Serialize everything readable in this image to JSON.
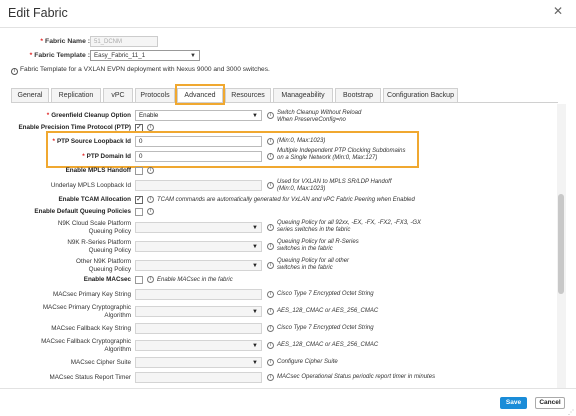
{
  "dialog": {
    "title": "Edit Fabric",
    "close_icon": "✕"
  },
  "fabric_name": {
    "label": "Fabric Name :",
    "value": "51_DCNM"
  },
  "fabric_template": {
    "label": "Fabric Template :",
    "value": "Easy_Fabric_11_1"
  },
  "info_text": "Fabric Template for a VXLAN EVPN deployment with Nexus 9000 and 3000 switches.",
  "tabs": [
    {
      "label": "General"
    },
    {
      "label": "Replication"
    },
    {
      "label": "vPC"
    },
    {
      "label": "Protocols"
    },
    {
      "label": "Advanced"
    },
    {
      "label": "Resources"
    },
    {
      "label": "Manageability"
    },
    {
      "label": "Bootstrap"
    },
    {
      "label": "Configuration Backup"
    }
  ],
  "active_tab": "Advanced",
  "fields": {
    "greenfield": {
      "label": "Greenfield Cleanup Option",
      "value": "Enable",
      "help": [
        "Switch Cleanup Without Reload",
        "When PreserveConfig=no"
      ]
    },
    "ptp": {
      "label": "Enable Precision Time Protocol (PTP)",
      "checked": "✓"
    },
    "ptp_loopback": {
      "label": "PTP Source Loopback Id",
      "value": "0",
      "help": [
        "(Min:0, Max:1023)"
      ]
    },
    "ptp_domain": {
      "label": "PTP Domain Id",
      "value": "0",
      "help": [
        "Multiple Independent PTP Clocking Subdomains",
        "on a Single Network (Min:0, Max:127)"
      ]
    },
    "mpls_handoff": {
      "label": "Enable MPLS Handoff"
    },
    "underlay_mpls": {
      "label": "Underlay MPLS Loopback Id",
      "help": [
        "Used for VXLAN to MPLS SR/LDP Handoff",
        "(Min:0, Max:1023)"
      ]
    },
    "tcam": {
      "label": "Enable TCAM Allocation",
      "checked": "✓",
      "help": [
        "TCAM commands are automatically generated for VxLAN and vPC Fabric Peering when Enabled"
      ]
    },
    "default_queuing": {
      "label": "Enable Default Queuing Policies"
    },
    "n9k_cloud": {
      "label": [
        "N9K Cloud Scale Platform",
        "Queuing Policy"
      ],
      "help": [
        "Queuing Policy for all 92xx, -EX, -FX, -FX2, -FX3, -GX",
        "series switches in the fabric"
      ]
    },
    "n9k_rseries": {
      "label": [
        "N9K R-Series Platform",
        "Queuing Policy"
      ],
      "help": [
        "Queuing Policy for all R-Series",
        "switches in the fabric"
      ]
    },
    "other_n9k": {
      "label": [
        "Other N9K Platform",
        "Queuing Policy"
      ],
      "help": [
        "Queuing Policy for all other",
        "switches in the fabric"
      ]
    },
    "macsec": {
      "label": "Enable MACsec",
      "help": [
        "Enable MACsec in the fabric"
      ]
    },
    "macsec_primary_key": {
      "label": "MACsec Primary Key String",
      "help": [
        "Cisco Type 7 Encrypted Octet String"
      ]
    },
    "macsec_primary_algo": {
      "label": [
        "MACsec Primary Cryptographic",
        "Algorithm"
      ],
      "help": [
        "AES_128_CMAC or AES_256_CMAC"
      ]
    },
    "macsec_fallback_key": {
      "label": "MACsec Fallback Key String",
      "help": [
        "Cisco Type 7 Encrypted Octet String"
      ]
    },
    "macsec_fallback_algo": {
      "label": [
        "MACsec Fallback Cryptographic",
        "Algorithm"
      ],
      "help": [
        "AES_128_CMAC or AES_256_CMAC"
      ]
    },
    "macsec_cipher": {
      "label": "MACsec Cipher Suite",
      "help": [
        "Configure Cipher Suite"
      ]
    },
    "macsec_timer": {
      "label": "MACsec Status Report Timer",
      "help": [
        "MACsec Operational Status periodic report timer in minutes"
      ]
    }
  },
  "footer": {
    "save_label": "Save",
    "cancel_label": "Cancel"
  },
  "colors": {
    "highlight": "#f0a830",
    "primary_button": "#1a8cd8",
    "required": "#e02020"
  },
  "icons": {
    "info": "i",
    "dropdown": "▼",
    "resize": "⋰"
  }
}
